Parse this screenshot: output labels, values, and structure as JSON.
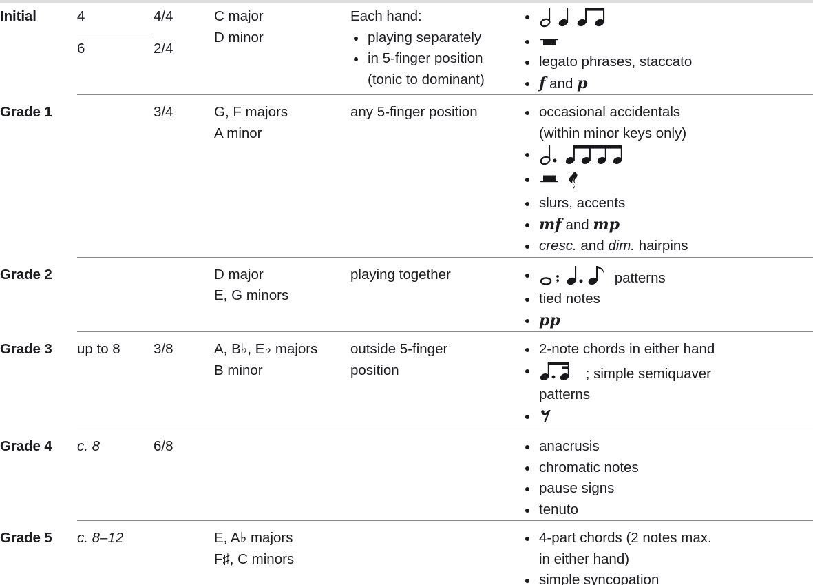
{
  "table": {
    "columns": [
      "grade",
      "bars",
      "time_signatures",
      "keys",
      "hands",
      "features"
    ],
    "rows": [
      {
        "grade": "Initial",
        "bars_primary": "4",
        "time_primary": "4/4",
        "bars_secondary": "6",
        "time_secondary": "2/4",
        "keys": [
          "C major",
          "D minor"
        ],
        "hands_intro": "Each hand:",
        "hands_bullets": [
          "playing separately",
          "in 5-finger position"
        ],
        "hands_continuation": "(tonic to dominant)",
        "features": [
          {
            "type": "notation",
            "glyph": "minim-crotchet-quavers",
            "text": ""
          },
          {
            "type": "notation",
            "glyph": "semibreve-rest",
            "text": ""
          },
          {
            "type": "text",
            "text": "legato phrases, staccato"
          },
          {
            "type": "dynamics",
            "text": "f and p",
            "marks": [
              "f",
              "p"
            ],
            "joiner": "and"
          }
        ]
      },
      {
        "grade": "Grade 1",
        "bars_primary": "",
        "time_primary": "3/4",
        "keys": [
          "G, F majors",
          "A minor"
        ],
        "hands_intro": "any 5-finger position",
        "hands_bullets": [],
        "features": [
          {
            "type": "text",
            "text": "occasional accidentals",
            "text_line2": "(within minor keys only)"
          },
          {
            "type": "notation",
            "glyph": "dotted-minim-four-quavers",
            "text": ""
          },
          {
            "type": "notation",
            "glyph": "minim-rest-crotchet-rest",
            "text": ""
          },
          {
            "type": "text",
            "text": "slurs, accents"
          },
          {
            "type": "dynamics",
            "text": "mf and mp",
            "marks": [
              "mf",
              "mp"
            ],
            "joiner": "and"
          },
          {
            "type": "text-italic",
            "text": "cresc. and dim. hairpins",
            "italic_parts": [
              "cresc.",
              "dim."
            ],
            "plain_parts": [
              "and",
              "hairpins"
            ]
          }
        ]
      },
      {
        "grade": "Grade 2",
        "bars_primary": "",
        "time_primary": "",
        "keys": [
          "D major",
          "E, G minors"
        ],
        "hands_intro": "playing together",
        "hands_bullets": [],
        "features": [
          {
            "type": "notation",
            "glyph": "semibreve-dotted-crotchet-quaver",
            "text": "patterns"
          },
          {
            "type": "text",
            "text": "tied notes"
          },
          {
            "type": "dynamics",
            "text": "pp",
            "marks": [
              "pp"
            ],
            "joiner": ""
          }
        ]
      },
      {
        "grade": "Grade 3",
        "bars_primary": "up to 8",
        "time_primary": "3/8",
        "keys": [
          "A, B♭, E♭ majors",
          "B minor"
        ],
        "hands_intro": "outside 5-finger",
        "hands_continuation": "position",
        "hands_bullets": [],
        "features": [
          {
            "type": "text",
            "text": "2-note chords in either hand"
          },
          {
            "type": "notation",
            "glyph": "dotted-quaver-semiquaver",
            "text": "; simple semiquaver",
            "text_line2": "patterns"
          },
          {
            "type": "notation",
            "glyph": "quaver-rest",
            "text": ""
          }
        ]
      },
      {
        "grade": "Grade 4",
        "bars_primary": "c. 8",
        "bars_italic_prefix": "c.",
        "time_primary": "6/8",
        "keys": [],
        "hands_intro": "",
        "hands_bullets": [],
        "features": [
          {
            "type": "text",
            "text": "anacrusis"
          },
          {
            "type": "text",
            "text": "chromatic notes"
          },
          {
            "type": "text",
            "text": "pause signs"
          },
          {
            "type": "text",
            "text": "tenuto"
          }
        ]
      },
      {
        "grade": "Grade 5",
        "bars_primary": "c. 8–12",
        "bars_italic_prefix": "c.",
        "time_primary": "",
        "keys": [
          "E, A♭ majors",
          "F♯, C minors"
        ],
        "hands_intro": "",
        "hands_bullets": [],
        "features": [
          {
            "type": "text",
            "text": "4-part chords (2 notes max.",
            "text_line2": "in either hand)"
          },
          {
            "type": "text-clipped",
            "text": "simple syncopation"
          }
        ]
      }
    ]
  },
  "style": {
    "rule_color": "#86868c",
    "text_color": "#1c1c22",
    "top_band_color": "#dedede",
    "bullet_color": "#17171c"
  }
}
